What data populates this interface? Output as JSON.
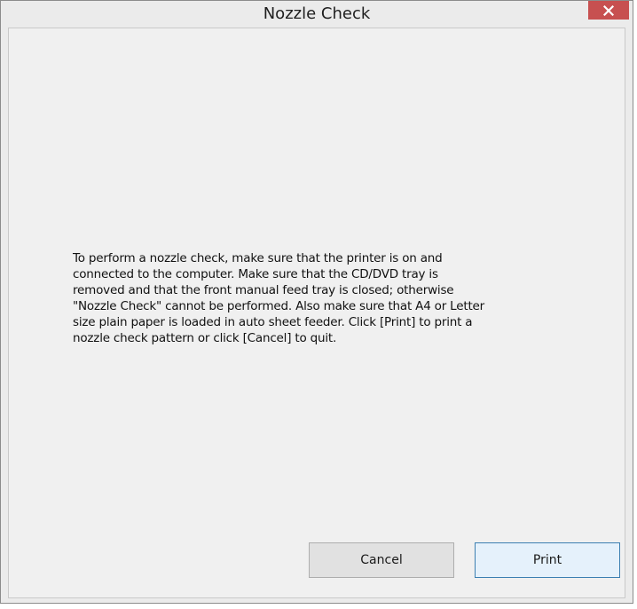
{
  "window": {
    "title": "Nozzle Check",
    "close_icon": "close-icon"
  },
  "message": {
    "text": "To perform a nozzle check, make sure that the printer is on and\nconnected to the computer. Make sure that the CD/DVD tray is\nremoved and that the front manual feed tray is closed; otherwise\n\"Nozzle Check\" cannot be performed. Also make sure that A4 or Letter\nsize plain paper is loaded in auto sheet feeder. Click [Print] to print a\nnozzle check pattern or click [Cancel] to quit."
  },
  "buttons": {
    "cancel_label": "Cancel",
    "print_label": "Print"
  },
  "colors": {
    "close_button": "#c75050",
    "default_button_border": "#3c7fb1"
  }
}
